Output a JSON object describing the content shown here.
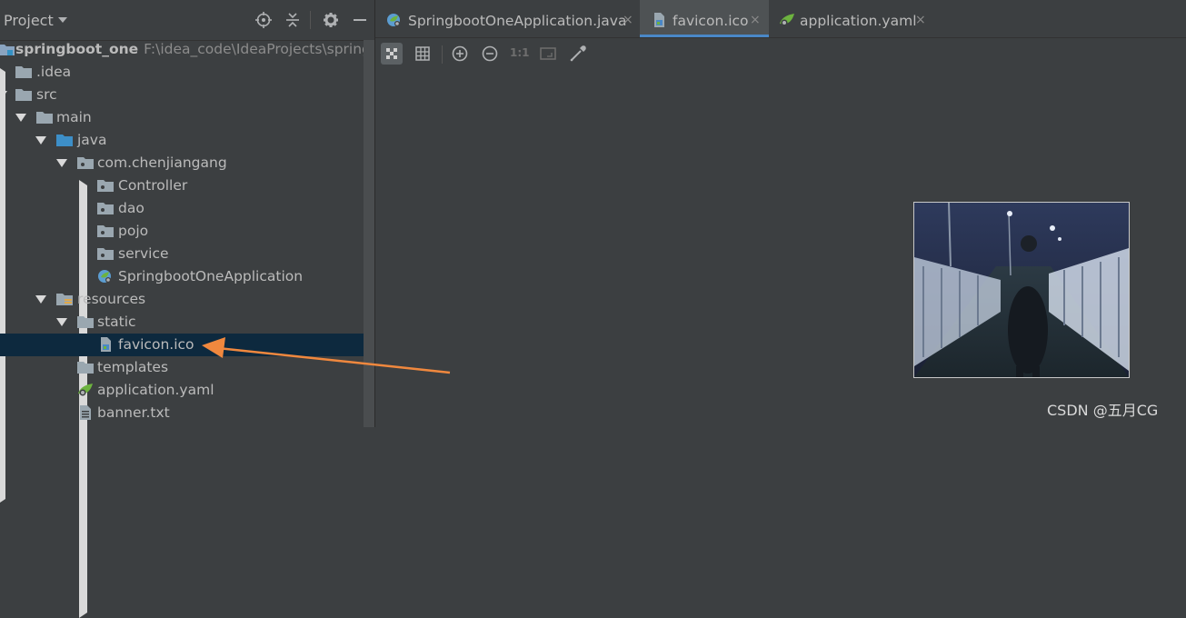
{
  "project_panel": {
    "title": "Project",
    "tree": [
      {
        "label": "springboot_one",
        "path": "F:\\idea_code\\IdeaProjects\\springboo",
        "icon": "module-folder-icon"
      },
      {
        "label": ".idea",
        "icon": "folder-icon"
      },
      {
        "label": "src",
        "icon": "folder-icon"
      },
      {
        "label": "main",
        "icon": "folder-icon"
      },
      {
        "label": "java",
        "icon": "source-folder-icon"
      },
      {
        "label": "com.chenjiangang",
        "icon": "package-icon"
      },
      {
        "label": "Controller",
        "icon": "package-icon"
      },
      {
        "label": "dao",
        "icon": "package-icon"
      },
      {
        "label": "pojo",
        "icon": "package-icon"
      },
      {
        "label": "service",
        "icon": "package-icon"
      },
      {
        "label": "SpringbootOneApplication",
        "icon": "spring-class-icon"
      },
      {
        "label": "resources",
        "icon": "resources-folder-icon"
      },
      {
        "label": "static",
        "icon": "folder-icon"
      },
      {
        "label": "favicon.ico",
        "icon": "image-file-icon",
        "selected": true
      },
      {
        "label": "templates",
        "icon": "folder-icon"
      },
      {
        "label": "application.yaml",
        "icon": "spring-yaml-icon"
      },
      {
        "label": "banner.txt",
        "icon": "text-file-icon"
      }
    ]
  },
  "tabs": [
    {
      "label": "SpringbootOneApplication.java",
      "icon": "spring-class-icon",
      "active": false
    },
    {
      "label": "favicon.ico",
      "icon": "image-file-icon",
      "active": true
    },
    {
      "label": "application.yaml",
      "icon": "spring-yaml-icon",
      "active": false
    }
  ],
  "tab_close": "×",
  "image_toolbar": {
    "actual_size_label": "1:1",
    "buttons": [
      "chessboard-icon",
      "grid-icon",
      "zoom-in-icon",
      "zoom-out-icon",
      "actual-size-icon",
      "fit-zoom-icon",
      "color-picker-icon"
    ]
  },
  "watermark": "CSDN @五月CG",
  "colors": {
    "accent": "#4a88c7",
    "selection": "#0d293e",
    "arrow": "#f0883e"
  }
}
